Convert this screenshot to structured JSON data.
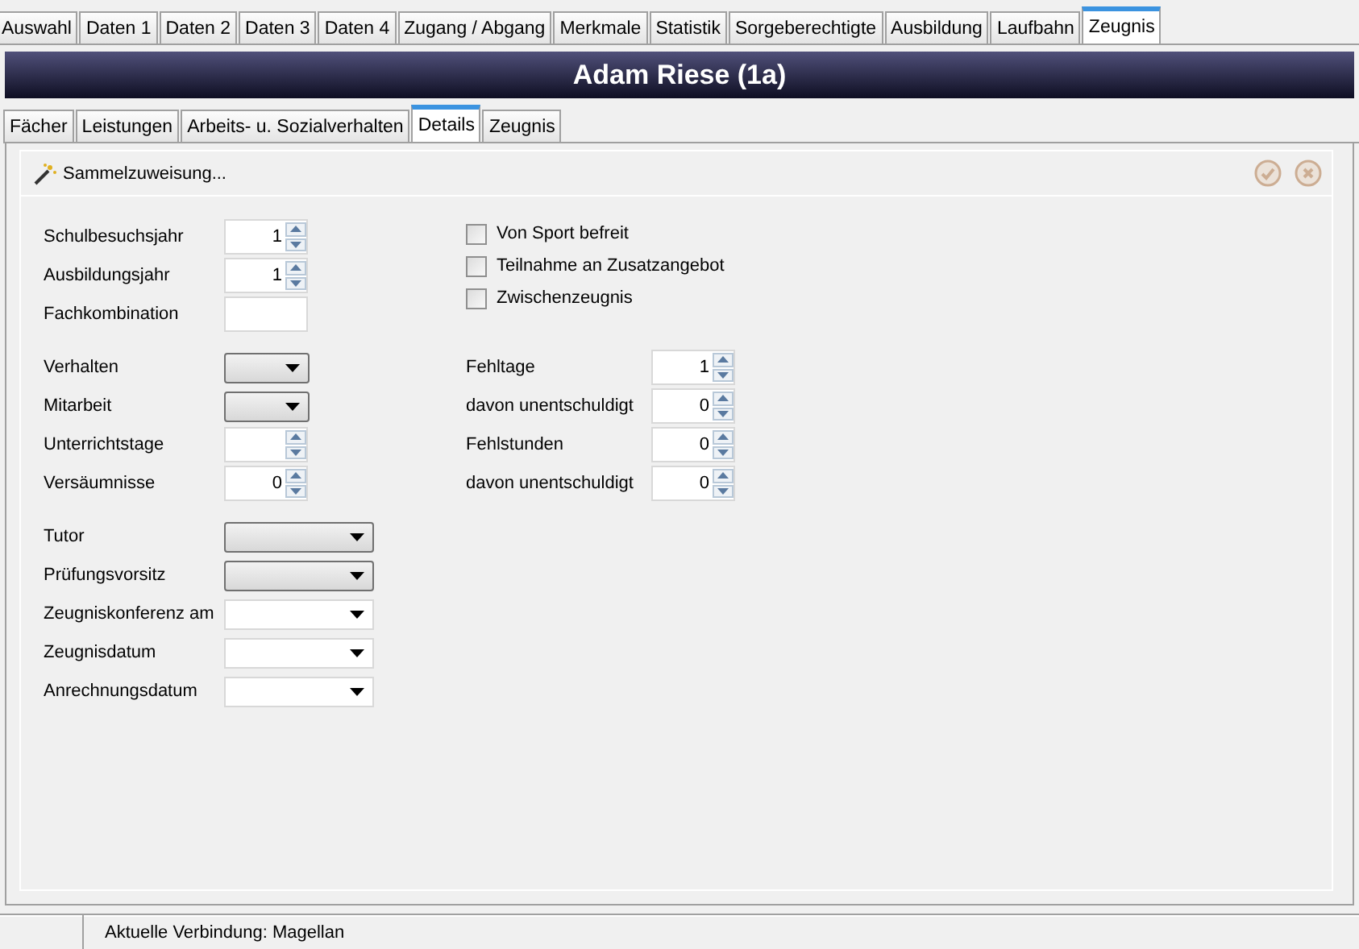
{
  "tabs": [
    {
      "label": "Auswahl",
      "selected": false
    },
    {
      "label": "Daten 1",
      "selected": false
    },
    {
      "label": "Daten 2",
      "selected": false
    },
    {
      "label": "Daten 3",
      "selected": false
    },
    {
      "label": "Daten 4",
      "selected": false
    },
    {
      "label": "Zugang / Abgang",
      "selected": false
    },
    {
      "label": "Merkmale",
      "selected": false
    },
    {
      "label": "Statistik",
      "selected": false
    },
    {
      "label": "Sorgeberechtigte",
      "selected": false
    },
    {
      "label": "Ausbildung",
      "selected": false
    },
    {
      "label": "Laufbahn",
      "selected": false
    },
    {
      "label": "Zeugnis",
      "selected": true
    }
  ],
  "header": {
    "title": "Adam Riese (1a)"
  },
  "subtabs": [
    {
      "label": "Fächer",
      "selected": false
    },
    {
      "label": "Leistungen",
      "selected": false
    },
    {
      "label": "Arbeits- u. Sozialverhalten",
      "selected": false
    },
    {
      "label": "Details",
      "selected": true
    },
    {
      "label": "Zeugnis",
      "selected": false
    }
  ],
  "toolbar": {
    "action": "Sammelzuweisung...",
    "save_disabled": true,
    "cancel_disabled": true
  },
  "sections": [
    {
      "left": [
        {
          "label": "Schulbesuchsjahr",
          "kind": "spinner",
          "value": "1"
        },
        {
          "label": "Ausbildungsjahr",
          "kind": "spinner",
          "value": "1"
        },
        {
          "label": "Fachkombination",
          "kind": "text"
        }
      ],
      "right": [
        {
          "label": "Von Sport befreit",
          "kind": "checkbox",
          "checked": false
        },
        {
          "label": "Teilnahme an Zusatzangebot",
          "kind": "checkbox",
          "checked": false
        },
        {
          "label": "Zwischenzeugnis",
          "kind": "checkbox",
          "checked": false
        }
      ]
    },
    {
      "left": [
        {
          "label": "Verhalten",
          "kind": "combo"
        },
        {
          "label": "Mitarbeit",
          "kind": "combo"
        },
        {
          "label": "Unterrichtstage",
          "kind": "spinner"
        },
        {
          "label": "Versäumnisse",
          "kind": "spinner",
          "value": "0"
        }
      ],
      "right": [
        {
          "label": "Fehltage",
          "kind": "spinner",
          "value": "1"
        },
        {
          "label": "davon unentschuldigt",
          "kind": "spinner",
          "value": "0"
        },
        {
          "label": "Fehlstunden",
          "kind": "spinner",
          "value": "0"
        },
        {
          "label": "davon unentschuldigt",
          "kind": "spinner",
          "value": "0"
        }
      ]
    },
    {
      "left": [
        {
          "label": "Tutor",
          "kind": "wide_combo"
        },
        {
          "label": "Prüfungsvorsitz",
          "kind": "wide_combo"
        },
        {
          "label": "Zeugniskonferenz am",
          "kind": "date"
        },
        {
          "label": "Zeugnisdatum",
          "kind": "date"
        },
        {
          "label": "Anrechnungsdatum",
          "kind": "date"
        }
      ]
    }
  ],
  "status_bar": {
    "text": "Aktuelle Verbindung: Magellan"
  }
}
